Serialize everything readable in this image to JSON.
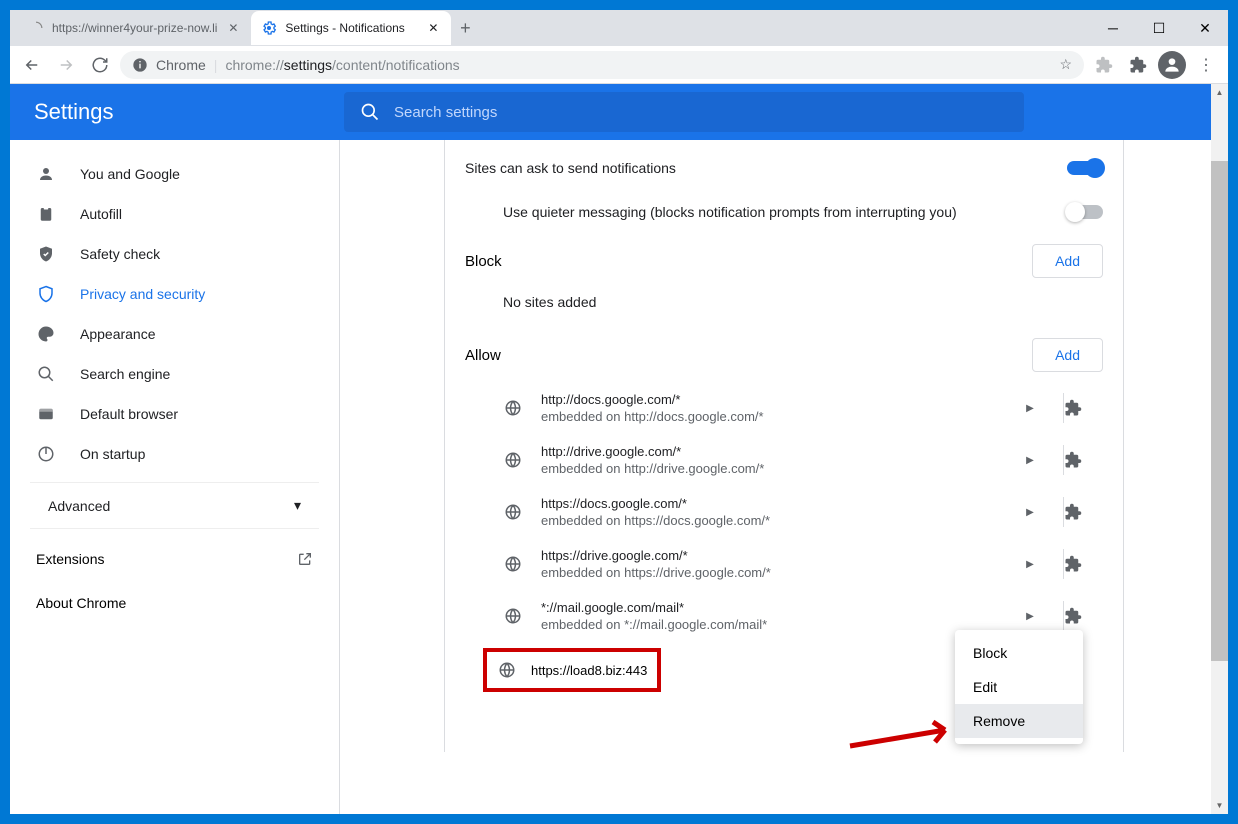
{
  "tabs": [
    {
      "title": "https://winner4your-prize-now.li",
      "active": false
    },
    {
      "title": "Settings - Notifications",
      "active": true
    }
  ],
  "omnibox": {
    "app": "Chrome",
    "url_pre": "chrome://",
    "url_bold": "settings",
    "url_post": "/content/notifications"
  },
  "header": {
    "title": "Settings"
  },
  "search": {
    "placeholder": "Search settings"
  },
  "sidebar": {
    "items": [
      {
        "label": "You and Google"
      },
      {
        "label": "Autofill"
      },
      {
        "label": "Safety check"
      },
      {
        "label": "Privacy and security"
      },
      {
        "label": "Appearance"
      },
      {
        "label": "Search engine"
      },
      {
        "label": "Default browser"
      },
      {
        "label": "On startup"
      }
    ],
    "advanced": "Advanced",
    "extensions": "Extensions",
    "about": "About Chrome"
  },
  "settings": {
    "ask_label": "Sites can ask to send notifications",
    "quiet_label": "Use quieter messaging (blocks notification prompts from interrupting you)",
    "block_label": "Block",
    "allow_label": "Allow",
    "add_label": "Add",
    "no_sites": "No sites added"
  },
  "allow_sites": [
    {
      "url": "http://docs.google.com/*",
      "embedded": "embedded on http://docs.google.com/*"
    },
    {
      "url": "http://drive.google.com/*",
      "embedded": "embedded on http://drive.google.com/*"
    },
    {
      "url": "https://docs.google.com/*",
      "embedded": "embedded on https://docs.google.com/*"
    },
    {
      "url": "https://drive.google.com/*",
      "embedded": "embedded on https://drive.google.com/*"
    },
    {
      "url": "*://mail.google.com/mail*",
      "embedded": "embedded on *://mail.google.com/mail*"
    }
  ],
  "highlighted_site": "https://load8.biz:443",
  "context_menu": {
    "items": [
      {
        "label": "Block"
      },
      {
        "label": "Edit"
      },
      {
        "label": "Remove"
      }
    ]
  },
  "colors": {
    "accent": "#1a73e8",
    "header": "#1a73e8",
    "annotation": "#c00000"
  }
}
